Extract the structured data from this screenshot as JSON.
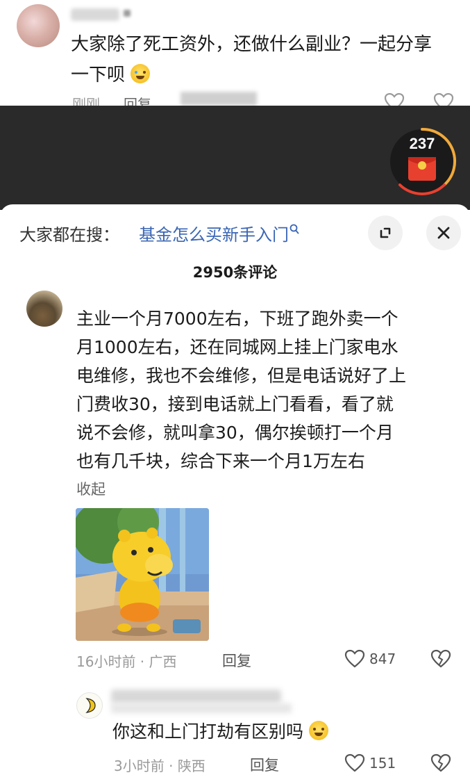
{
  "original_post": {
    "text_line1": "大家除了死工资外，还做什么副业？一起分享",
    "text_line2": "一下呗",
    "time": "刚刚",
    "reply": "回复"
  },
  "red_packet": {
    "count": "237"
  },
  "search_bar": {
    "label": "大家都在搜：",
    "term": "基金怎么买新手入门"
  },
  "comments_header": {
    "count_label": "2950条评论"
  },
  "comment": {
    "lines": [
      "主业一个月7000左右，下班了跑外卖一个",
      "月1000左右，还在同城网上挂上门家电水",
      "电维修，我也不会维修，但是电话说好了上",
      "门费收30，接到电话就上门看看，看了就",
      "说不会修，就叫拿30，偶尔挨顿打一个月",
      "也有几千块，综合下来一个月1万左右"
    ],
    "collapse": "收起",
    "time": "16小时前",
    "location": "广西",
    "reply": "回复",
    "likes": "847"
  },
  "reply_comment": {
    "text": "你这和上门打劫有区别吗",
    "time": "3小时前",
    "location": "陕西",
    "reply": "回复",
    "likes": "151"
  },
  "separator": " · ",
  "colors": {
    "link_blue": "#3a66b4",
    "dark_band": "#2a2a2a",
    "packet_red": "#e8402f",
    "ring_orange": "#f0a93a"
  }
}
